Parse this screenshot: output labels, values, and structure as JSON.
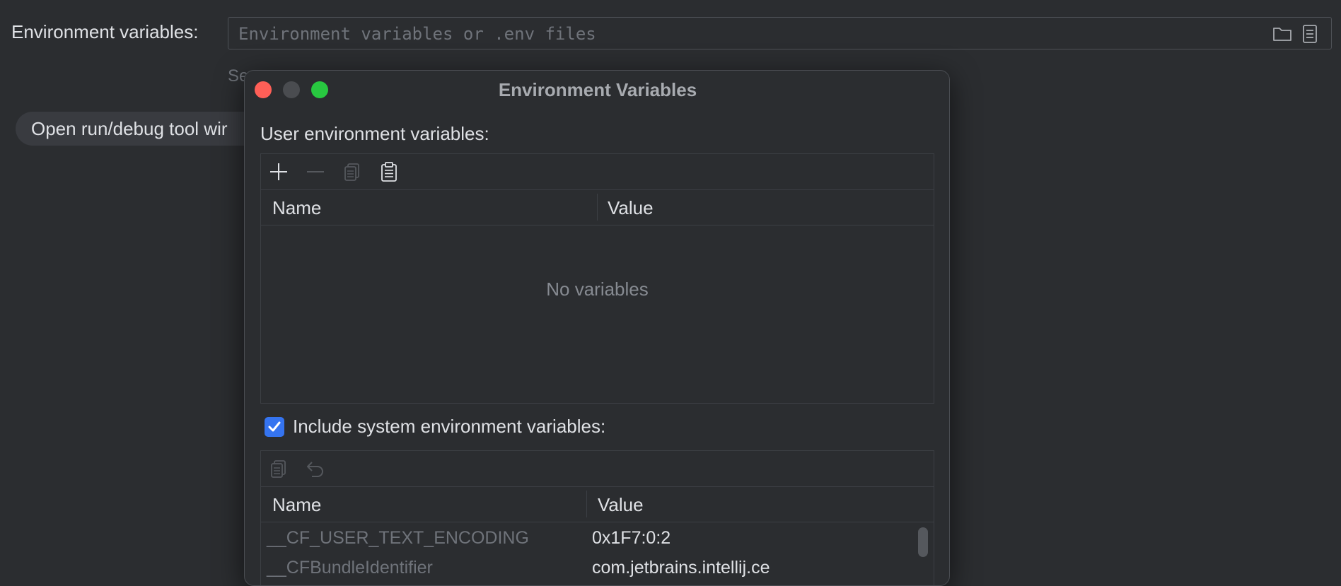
{
  "form": {
    "env_label": "Environment variables:",
    "env_placeholder": "Environment variables or .env files",
    "see_text": "Se",
    "open_button": "Open run/debug tool wir",
    "icons": [
      "folder-icon",
      "document-icon"
    ]
  },
  "dialog": {
    "title": "Environment Variables",
    "user_section_label": "User environment variables:",
    "user_toolbar": [
      "add-icon",
      "remove-icon",
      "copy-icon",
      "paste-icon"
    ],
    "user_table": {
      "columns": [
        "Name",
        "Value"
      ],
      "empty_text": "No variables"
    },
    "include_system": {
      "checked": true,
      "label": "Include system environment variables:"
    },
    "system_toolbar": [
      "copy-icon",
      "undo-icon"
    ],
    "system_table": {
      "columns": [
        "Name",
        "Value"
      ],
      "rows": [
        {
          "name": "__CF_USER_TEXT_ENCODING",
          "value": "0x1F7:0:2"
        },
        {
          "name": "__CFBundleIdentifier",
          "value": "com.jetbrains.intellij.ce"
        }
      ]
    }
  },
  "colors": {
    "background": "#2b2d30",
    "accent": "#3574f0",
    "close": "#ff5f57",
    "minimize": "#4a4c50",
    "maximize": "#28c840"
  }
}
